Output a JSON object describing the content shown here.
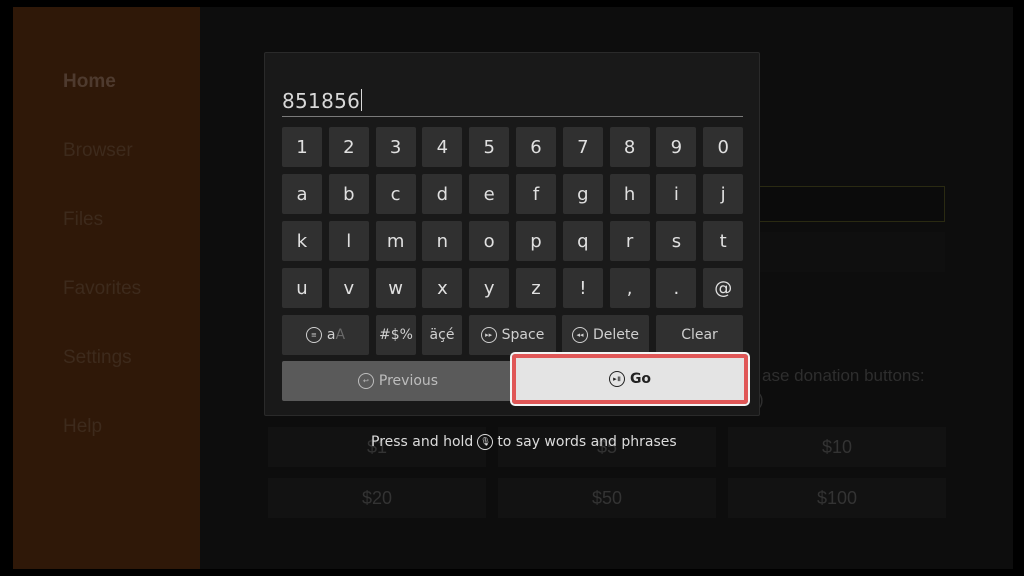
{
  "sidebar": {
    "items": [
      {
        "label": "Home",
        "active": true
      },
      {
        "label": "Browser"
      },
      {
        "label": "Files"
      },
      {
        "label": "Favorites"
      },
      {
        "label": "Settings"
      },
      {
        "label": "Help"
      }
    ]
  },
  "background": {
    "donation_text_line1": "ase donation buttons:",
    "donation_text_line2": ")",
    "donation_buttons": [
      "$1",
      "$5",
      "$10",
      "$20",
      "$50",
      "$100"
    ]
  },
  "keyboard": {
    "input_value": "851856",
    "rows": [
      [
        "1",
        "2",
        "3",
        "4",
        "5",
        "6",
        "7",
        "8",
        "9",
        "0"
      ],
      [
        "a",
        "b",
        "c",
        "d",
        "e",
        "f",
        "g",
        "h",
        "i",
        "j"
      ],
      [
        "k",
        "l",
        "m",
        "n",
        "o",
        "p",
        "q",
        "r",
        "s",
        "t"
      ],
      [
        "u",
        "v",
        "w",
        "x",
        "y",
        "z",
        "!",
        ",",
        ".",
        "@"
      ]
    ],
    "case_toggle": {
      "label_lower": "a",
      "label_upper": "A",
      "icon": "menu-icon"
    },
    "symbols_label": "#$%",
    "accents_label": "äçé",
    "space_label": "Space",
    "space_icon": "fast-forward-icon",
    "delete_label": "Delete",
    "delete_icon": "rewind-icon",
    "clear_label": "Clear",
    "previous_label": "Previous",
    "previous_icon": "back-icon",
    "go_label": "Go",
    "go_icon": "play-pause-icon",
    "focused_key": "Go"
  },
  "hint": {
    "before": "Press and hold",
    "icon": "microphone-icon",
    "after": "to say words and phrases"
  },
  "colors": {
    "focus_border": "#e05757",
    "sidebar_bg": "#2f1808"
  }
}
